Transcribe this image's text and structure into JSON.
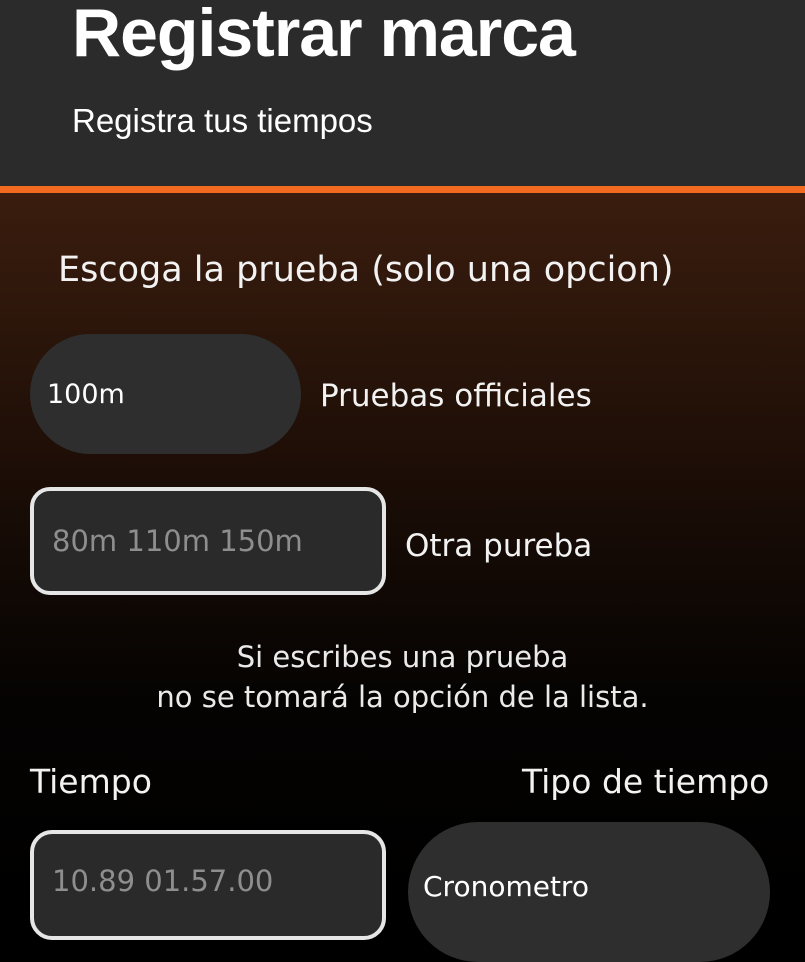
{
  "header": {
    "title": "Registrar marca",
    "subtitle": "Registra tus tiempos"
  },
  "colors": {
    "header_bg": "#2b2b2b",
    "accent": "#f26a1f",
    "field_bg": "#2e2e2e"
  },
  "form": {
    "event_prompt": "Escoga la prueba (solo una opcion)",
    "official_event": {
      "selected": "100m",
      "caption": "Pruebas officiales"
    },
    "other_event": {
      "placeholder": "80m 110m 150m",
      "caption": "Otra pureba"
    },
    "note_line1": "Si escribes una prueba",
    "note_line2": "no se tomará la opción de la lista.",
    "time": {
      "label": "Tiempo",
      "placeholder": "10.89 01.57.00"
    },
    "time_type": {
      "label": "Tipo de tiempo",
      "selected": "Cronometro"
    }
  }
}
